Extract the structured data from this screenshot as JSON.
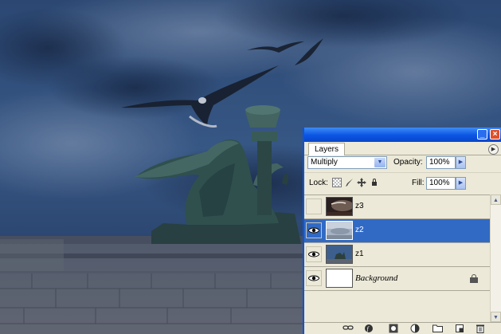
{
  "panel": {
    "tab_label": "Layers",
    "blend_mode": "Multiply",
    "opacity_label": "Opacity:",
    "opacity_value": "100%",
    "lock_label": "Lock:",
    "fill_label": "Fill:",
    "fill_value": "100%"
  },
  "layers": [
    {
      "name": "z3",
      "visible": false,
      "selected": false
    },
    {
      "name": "z2",
      "visible": true,
      "selected": true
    },
    {
      "name": "z1",
      "visible": true,
      "selected": false
    },
    {
      "name": "Background",
      "visible": true,
      "selected": false,
      "locked": true
    }
  ],
  "colors": {
    "selection": "#316ac5",
    "titlebar": "#0a55e3",
    "panel_bg": "#ece9d8"
  },
  "icons": [
    "minimize-icon",
    "close-icon",
    "palette-menu-icon",
    "lock-transparent-icon",
    "lock-brush-icon",
    "lock-move-icon",
    "lock-all-icon",
    "eye-icon",
    "link-icon",
    "layer-style-icon",
    "mask-icon",
    "adjustment-icon",
    "folder-icon",
    "new-layer-icon",
    "trash-icon"
  ]
}
